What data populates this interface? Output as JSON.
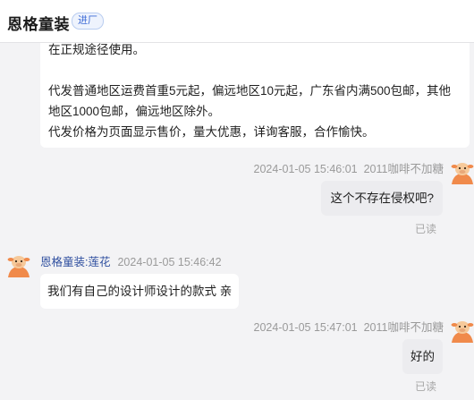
{
  "header": {
    "shop_name": "恩格童装",
    "tag": "进厂"
  },
  "messages": {
    "m1": {
      "lines": [
        "在正规途径使用。",
        "",
        "代发普通地区运费首重5元起，偏远地区10元起，广东省内满500包邮，其他",
        "地区1000包邮，偏远地区除外。",
        "代发价格为页面显示售价，量大优惠，详询客服，合作愉快。"
      ]
    },
    "m2": {
      "time": "2024-01-05 15:46:01",
      "sender": "2011咖啡不加糖",
      "text": "这个不存在侵权吧?",
      "status": "已读"
    },
    "m3": {
      "sender": "恩格童装:莲花",
      "time": "2024-01-05 15:46:42",
      "text": "我们有自己的设计师设计的款式 亲"
    },
    "m4": {
      "time": "2024-01-05 15:47:01",
      "sender": "2011咖啡不加糖",
      "text": "好的",
      "status": "已读"
    }
  },
  "colors": {
    "accent_blue": "#3d6bd6",
    "avatar_orange": "#f08a4b"
  },
  "icons": {
    "avatar": "cartoon-cow-avatar"
  }
}
